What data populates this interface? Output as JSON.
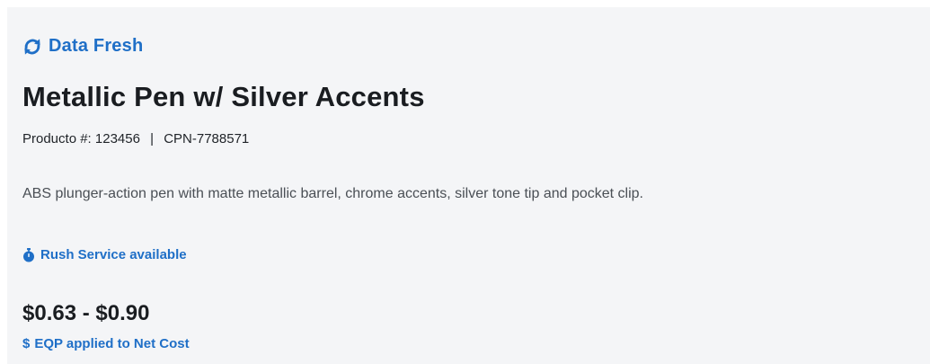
{
  "status": {
    "label": "Data Fresh",
    "icon": "refresh-icon",
    "color": "#1f6fc7"
  },
  "product": {
    "title": "Metallic Pen w/ Silver Accents",
    "number_label": "Producto #:",
    "number": "123456",
    "separator": "|",
    "cpn": "CPN-7788571",
    "description": "ABS plunger-action pen with matte metallic barrel, chrome accents, silver tone tip and pocket clip."
  },
  "rush": {
    "label": "Rush Service available",
    "icon": "stopwatch-icon"
  },
  "pricing": {
    "range": "$0.63 - $0.90",
    "eqp_icon": "$",
    "eqp_label": "EQP applied to Net Cost"
  },
  "colors": {
    "accent": "#1f6fc7",
    "background": "#f4f5f7",
    "text": "#1a1d21",
    "muted": "#4a4f55"
  }
}
